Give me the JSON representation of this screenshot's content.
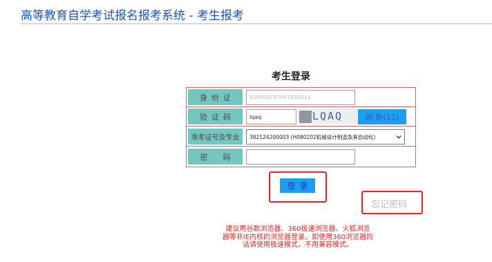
{
  "header": {
    "title": "高等教育自学考试报名报考系统 - 考生报考"
  },
  "login": {
    "title": "考生登录",
    "fields": {
      "id_label": "身份证",
      "id_value": "510000107007201011",
      "captcha_label": "验证码",
      "captcha_value": "lqaq",
      "captcha_image_text": "LQAQ",
      "refresh_label": "刷 新(11)",
      "major_label": "准考证号及专业",
      "major_selected": "382124200003 (H080202机械设计制造及其自动化)",
      "password_label": "密码",
      "password_value": ""
    },
    "submit_label": "登录",
    "forgot_label": "忘记密码"
  },
  "notice": {
    "lines": [
      "建议用谷歌浏览器、360极速浏览器、火狐浏览",
      "器等非IE内核的浏览器登录。如使用360浏览器的",
      "话请使用极速模式，不用兼容模式。"
    ]
  },
  "colors": {
    "title_blue": "#1a56b0",
    "label_teal": "#74c6c1",
    "button_blue": "#1e9ef0",
    "highlight_red": "#f21e1e",
    "notice_red": "#e21e1e",
    "table_border": "#d36464"
  }
}
